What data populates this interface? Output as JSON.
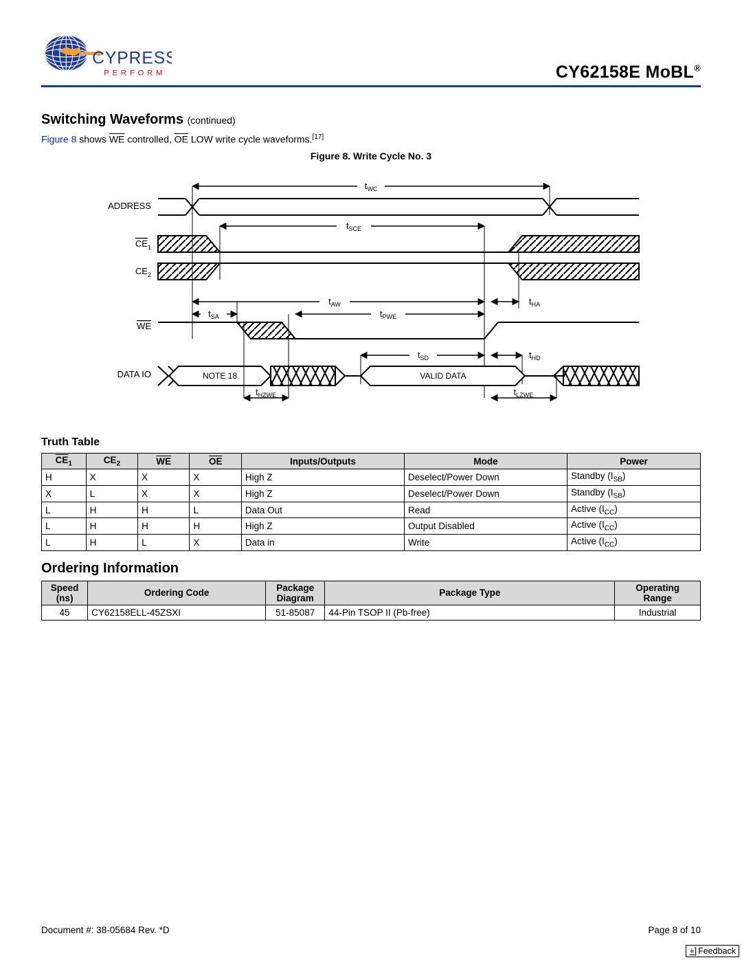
{
  "header": {
    "product": "CY62158E MoBL",
    "logo_main": "CYPRESS",
    "logo_tag": "P E R F O R M"
  },
  "section": {
    "title": "Switching Waveforms",
    "continued": "(continued)",
    "intro_pre": "Figure 8",
    "intro_mid1": " shows ",
    "intro_we": "WE",
    "intro_mid2": " controlled, ",
    "intro_oe": "OE",
    "intro_post": " LOW write cycle waveforms.",
    "note_ref": "[17]",
    "fig_caption": "Figure 8.  Write Cycle No. 3"
  },
  "diagram": {
    "labels": {
      "address": "ADDRESS",
      "ce1_pre": "CE",
      "ce1_sub": "1",
      "ce2_pre": "CE",
      "ce2_sub": "2",
      "we": "WE",
      "data_io": "DATA  IO"
    },
    "timings": {
      "twc": "WC",
      "tsce": "SCE",
      "taw": "AW",
      "tha": "HA",
      "tsa": "SA",
      "tpwe": "PWE",
      "tsd": "SD",
      "thd": "HD",
      "thzwe": "HZWE",
      "tlzwe": "LZWE"
    },
    "note18": "NOTE 18",
    "valid": "VALID DATA"
  },
  "truth": {
    "title": "Truth Table",
    "headers": {
      "ce1": "CE",
      "ce1sub": "1",
      "ce2": "CE",
      "ce2sub": "2",
      "we": "WE",
      "oe": "OE",
      "io": "Inputs/Outputs",
      "mode": "Mode",
      "power": "Power"
    },
    "rows": [
      {
        "ce1": "H",
        "ce2": "X",
        "we": "X",
        "oe": "X",
        "io": "High Z",
        "mode": "Deselect/Power Down",
        "p_pre": "Standby (I",
        "p_sub": "SB",
        "p_post": ")"
      },
      {
        "ce1": "X",
        "ce2": "L",
        "we": "X",
        "oe": "X",
        "io": "High Z",
        "mode": "Deselect/Power Down",
        "p_pre": "Standby (I",
        "p_sub": "SB",
        "p_post": ")"
      },
      {
        "ce1": "L",
        "ce2": "H",
        "we": "H",
        "oe": "L",
        "io": "Data Out",
        "mode": "Read",
        "p_pre": "Active (I",
        "p_sub": "CC",
        "p_post": ")"
      },
      {
        "ce1": "L",
        "ce2": "H",
        "we": "H",
        "oe": "H",
        "io": "High Z",
        "mode": "Output Disabled",
        "p_pre": "Active (I",
        "p_sub": "CC",
        "p_post": ")"
      },
      {
        "ce1": "L",
        "ce2": "H",
        "we": "L",
        "oe": "X",
        "io": "Data in",
        "mode": "Write",
        "p_pre": "Active (I",
        "p_sub": "CC",
        "p_post": ")"
      }
    ]
  },
  "ordering": {
    "title": "Ordering Information",
    "headers": {
      "speed_l1": "Speed",
      "speed_l2": "(ns)",
      "code": "Ordering Code",
      "pkg_l1": "Package",
      "pkg_l2": "Diagram",
      "pkgtype": "Package Type",
      "range_l1": "Operating",
      "range_l2": "Range"
    },
    "row": {
      "speed": "45",
      "code": "CY62158ELL-45ZSXI",
      "pkg": "51-85087",
      "pkgtype": "44-Pin TSOP II (Pb-free)",
      "range": "Industrial"
    }
  },
  "footer": {
    "doc": "Document #: 38-05684 Rev. *D",
    "page": "Page 8 of 10",
    "feedback_plus": "+]",
    "feedback": "Feedback"
  }
}
